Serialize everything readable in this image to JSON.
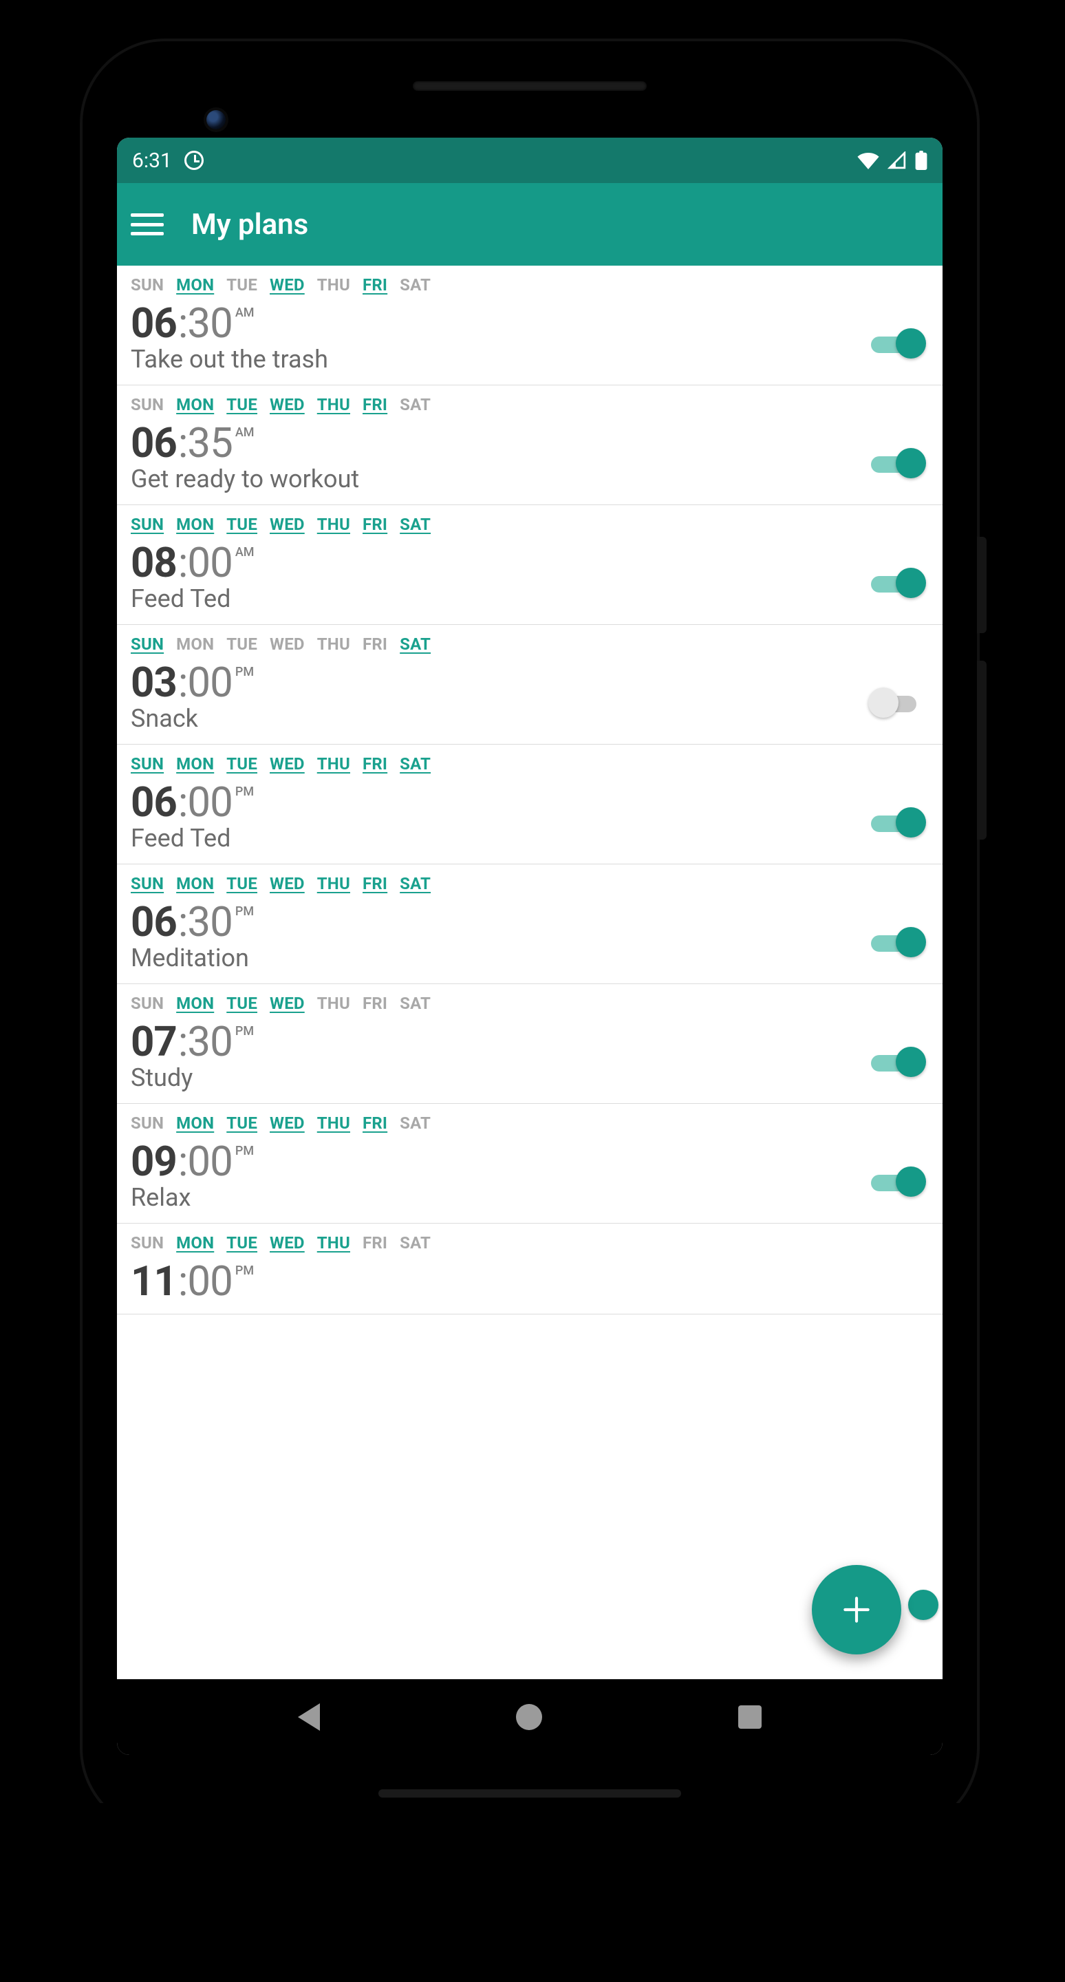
{
  "statusbar": {
    "time": "6:31"
  },
  "appbar": {
    "title": "My plans"
  },
  "days_labels": [
    "SUN",
    "MON",
    "TUE",
    "WED",
    "THU",
    "FRI",
    "SAT"
  ],
  "plans": [
    {
      "days": [
        false,
        true,
        false,
        true,
        false,
        true,
        false
      ],
      "hour": "06",
      "minute": ":30",
      "ampm": "AM",
      "label": "Take out the trash",
      "on": true
    },
    {
      "days": [
        false,
        true,
        true,
        true,
        true,
        true,
        false
      ],
      "hour": "06",
      "minute": ":35",
      "ampm": "AM",
      "label": "Get ready to workout",
      "on": true
    },
    {
      "days": [
        true,
        true,
        true,
        true,
        true,
        true,
        true
      ],
      "hour": "08",
      "minute": ":00",
      "ampm": "AM",
      "label": "Feed Ted",
      "on": true
    },
    {
      "days": [
        true,
        false,
        false,
        false,
        false,
        false,
        true
      ],
      "hour": "03",
      "minute": ":00",
      "ampm": "PM",
      "label": "Snack",
      "on": false
    },
    {
      "days": [
        true,
        true,
        true,
        true,
        true,
        true,
        true
      ],
      "hour": "06",
      "minute": ":00",
      "ampm": "PM",
      "label": "Feed Ted",
      "on": true
    },
    {
      "days": [
        true,
        true,
        true,
        true,
        true,
        true,
        true
      ],
      "hour": "06",
      "minute": ":30",
      "ampm": "PM",
      "label": "Meditation",
      "on": true
    },
    {
      "days": [
        false,
        true,
        true,
        true,
        false,
        false,
        false
      ],
      "hour": "07",
      "minute": ":30",
      "ampm": "PM",
      "label": "Study",
      "on": true
    },
    {
      "days": [
        false,
        true,
        true,
        true,
        true,
        true,
        false
      ],
      "hour": "09",
      "minute": ":00",
      "ampm": "PM",
      "label": "Relax",
      "on": true
    },
    {
      "days": [
        false,
        true,
        true,
        true,
        true,
        false,
        false
      ],
      "hour": "11",
      "minute": ":00",
      "ampm": "PM",
      "label": "",
      "on": true
    }
  ],
  "fab": {
    "label": "+"
  }
}
